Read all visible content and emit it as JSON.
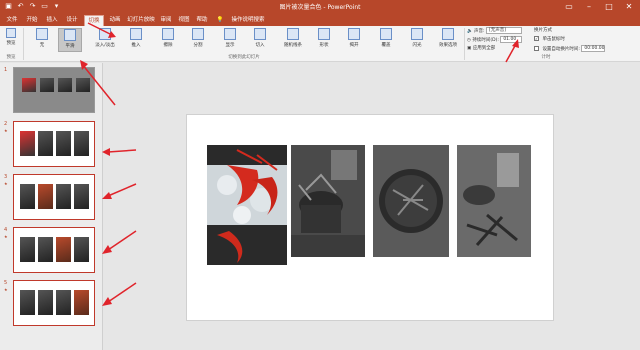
{
  "titlebar": {
    "title": "图片被次量合色 - PowerPoint",
    "quick_access": [
      "save-icon",
      "undo-icon",
      "redo-icon",
      "start-from-beginning-icon",
      "customize-icon"
    ],
    "window_buttons": [
      "ribbon-display-icon",
      "minimize-icon",
      "maximize-icon",
      "close-icon"
    ]
  },
  "menu": {
    "tabs": [
      "文件",
      "开始",
      "插入",
      "设计",
      "切换",
      "动画",
      "幻灯片放映",
      "审阅",
      "视图",
      "帮助"
    ],
    "active_tab": "切换",
    "tell_me": "操作说明搜索"
  },
  "ribbon": {
    "preview": {
      "label": "预览",
      "group": "预览"
    },
    "transitions": [
      "无",
      "平滑",
      "淡入/淡出",
      "推入",
      "擦除",
      "分割",
      "显示",
      "切入",
      "随机线条",
      "形状",
      "揭开",
      "覆盖",
      "闪光"
    ],
    "selected_transition": "平滑",
    "effect_options": "效果选项",
    "group_transitions": "切换到此幻灯片",
    "timing": {
      "sound_label": "声音:",
      "sound_value": "[无声音]",
      "duration_label": "持续时间(D):",
      "duration_value": "01.00",
      "apply_all": "应用到全部",
      "advance_title": "换片方式",
      "on_click": "单击鼠标时",
      "after_label": "设置自动换片时间:",
      "after_value": "00:00.00",
      "group": "计时"
    }
  },
  "slides": [
    {
      "number": "1",
      "marker": ""
    },
    {
      "number": "2",
      "marker": "★"
    },
    {
      "number": "3",
      "marker": "★"
    },
    {
      "number": "4",
      "marker": "★"
    },
    {
      "number": "5",
      "marker": "★"
    }
  ],
  "colors": {
    "brand": "#b7472a",
    "annotation_red": "#e0242b"
  }
}
